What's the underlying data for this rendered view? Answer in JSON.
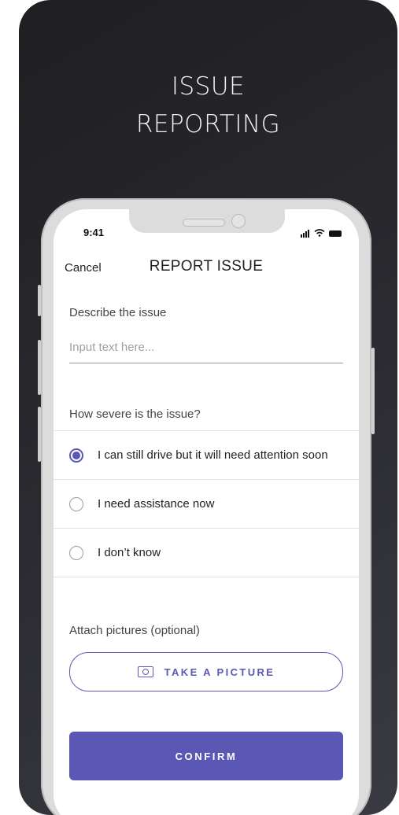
{
  "poster": {
    "headline_line1": "ISSUE",
    "headline_line2": "REPORTING"
  },
  "status_bar": {
    "time": "9:41",
    "icons": [
      "signal-icon",
      "wifi-icon",
      "battery-icon"
    ]
  },
  "navbar": {
    "cancel_label": "Cancel",
    "title": "REPORT ISSUE"
  },
  "form": {
    "describe_label": "Describe the issue",
    "input_placeholder": "Input text here...",
    "severity_label": "How severe is the issue?",
    "options": [
      {
        "label": "I can still drive but it will need attention soon",
        "selected": true
      },
      {
        "label": "I need assistance now",
        "selected": false
      },
      {
        "label": "I don’t know",
        "selected": false
      }
    ],
    "attach_label": "Attach pictures (optional)",
    "take_picture_label": "TAKE A PICTURE",
    "confirm_label": "CONFIRM"
  },
  "colors": {
    "accent": "#5b57b4",
    "poster_bg": "#26262b"
  }
}
